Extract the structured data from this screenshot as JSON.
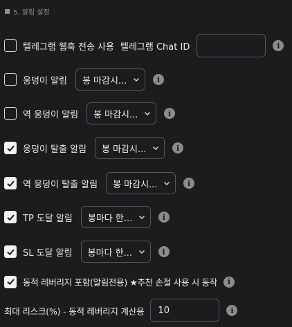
{
  "section": {
    "title": "5. 알림 설정"
  },
  "rows": [
    {
      "label": "텔레그램 웹훅 전송 사용",
      "checked": false,
      "extra_label": "텔레그램 Chat ID",
      "input_value": ""
    },
    {
      "label": "웅덩이 알림",
      "checked": false,
      "select_value": "봉 마감시..."
    },
    {
      "label": "역 웅덩이 알림",
      "checked": false,
      "select_value": "봉 마감시..."
    },
    {
      "label": "웅덩이 탈출 알림",
      "checked": true,
      "select_value": "봉 마감시..."
    },
    {
      "label": "역 웅덩이 탈출 알림",
      "checked": true,
      "select_value": "봉 마감시..."
    },
    {
      "label": "TP 도달 알림",
      "checked": true,
      "select_value": "봉마다 한..."
    },
    {
      "label": "SL 도달 알림",
      "checked": true,
      "select_value": "봉마다 한..."
    },
    {
      "label": "동적 레버리지 포함(알림전용) ★추천 손절 사용 시 동작",
      "checked": true
    }
  ],
  "max_risk": {
    "label": "최대 리스크(%) - 동적 레버리지 계산용",
    "value": "10"
  },
  "icons": {
    "info": "info-icon",
    "checkbox_check": "check-icon",
    "dropdown": "chevron-down-icon"
  },
  "colors": {
    "background": "#1b1c1e",
    "text": "#e8e8e8",
    "border": "#54565a",
    "info_icon": "#8c8c8c"
  }
}
